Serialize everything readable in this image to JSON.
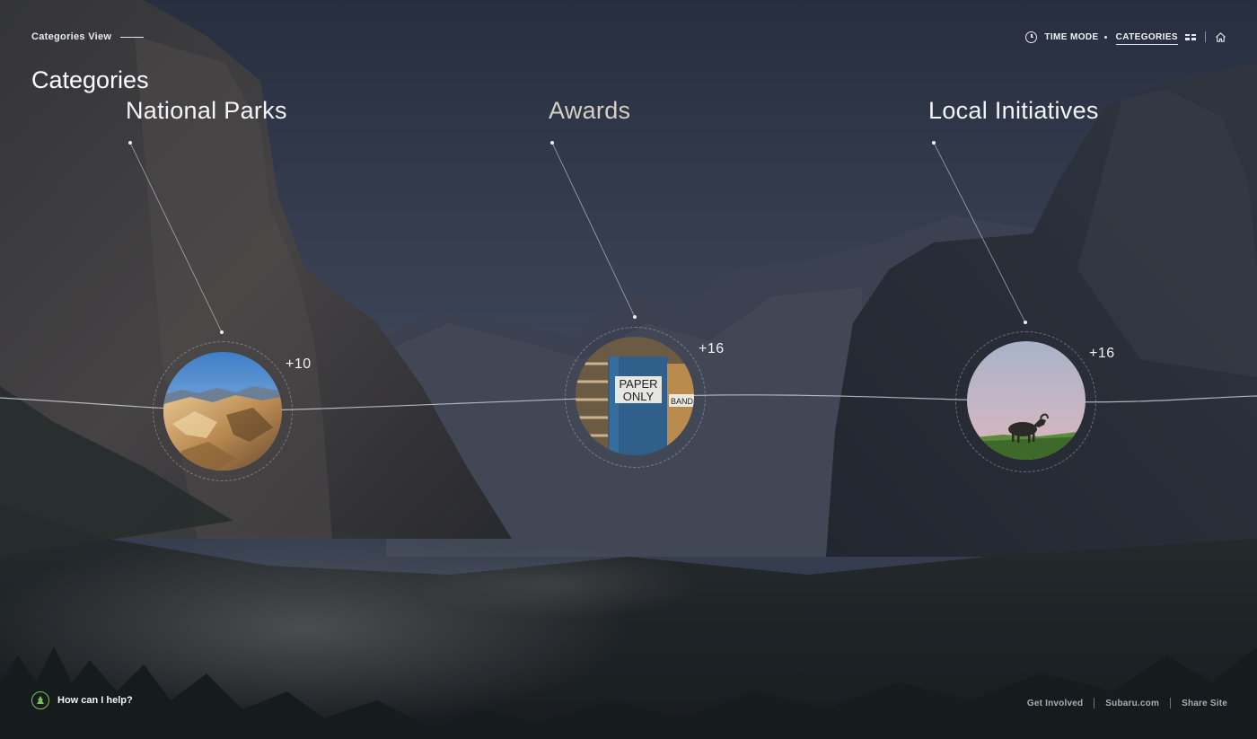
{
  "header": {
    "view_label": "Categories View",
    "page_title": "Categories",
    "nav": {
      "time_mode": "TIME MODE",
      "categories": "CATEGORIES"
    }
  },
  "categories": [
    {
      "title": "National Parks",
      "count": "+10",
      "image": "mountain-rock-photo"
    },
    {
      "title": "Awards",
      "count": "+16",
      "image": "paper-only-bin-photo"
    },
    {
      "title": "Local Initiatives",
      "count": "+16",
      "image": "goat-sunset-photo"
    }
  ],
  "footer": {
    "help": "How can I help?",
    "links": [
      "Get Involved",
      "Subaru.com",
      "Share Site"
    ]
  },
  "icons": {
    "time": "clock-icon",
    "grid": "grid-icon",
    "home": "home-icon",
    "help": "tree-icon"
  },
  "colors": {
    "accent_green": "#7fbf5a"
  }
}
